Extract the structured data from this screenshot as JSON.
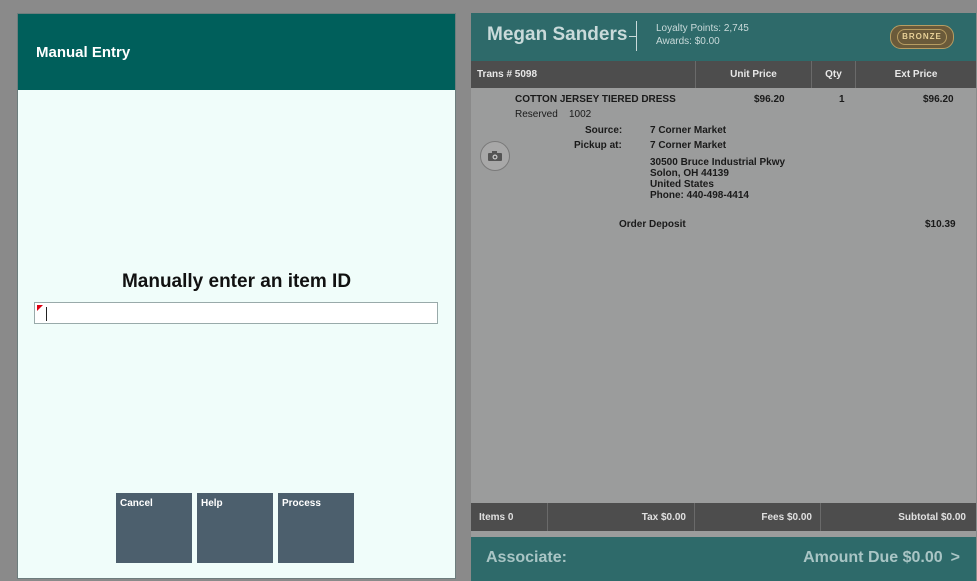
{
  "manual_entry": {
    "title": "Manual Entry",
    "prompt": "Manually enter an item ID",
    "input_value": "",
    "buttons": {
      "cancel": "Cancel",
      "help": "Help",
      "process": "Process"
    }
  },
  "customer": {
    "name": "Megan Sanders",
    "loyalty_points": "Loyalty Points: 2,745",
    "awards": "Awards: $0.00",
    "tier": "BRONZE"
  },
  "transaction": {
    "headers": {
      "trans": "Trans # 5098",
      "unit_price": "Unit Price",
      "qty": "Qty",
      "ext_price": "Ext Price"
    },
    "item": {
      "name": "COTTON JERSEY TIERED DRESS",
      "unit_price": "$96.20",
      "qty": "1",
      "ext_price": "$96.20",
      "status": "Reserved",
      "code": "1002",
      "source_label": "Source:",
      "source_value": "7 Corner Market",
      "pickup_label": "Pickup at:",
      "pickup_value": "7 Corner Market",
      "address1": "30500 Bruce Industrial Pkwy",
      "address2": "Solon, OH 44139",
      "country": "United States",
      "phone": "Phone: 440-498-4414"
    },
    "deposit": {
      "label": "Order Deposit",
      "amount": "$10.39"
    }
  },
  "totals": {
    "items": "Items 0",
    "tax": "Tax $0.00",
    "fees": "Fees $0.00",
    "subtotal": "Subtotal $0.00"
  },
  "footer": {
    "associate": "Associate:",
    "amount_due": "Amount Due $0.00",
    "chevron": ">"
  },
  "colors": {
    "header_teal": "#005f5b",
    "footer_teal": "#2e6a6a",
    "button": "#4c5f6d"
  }
}
